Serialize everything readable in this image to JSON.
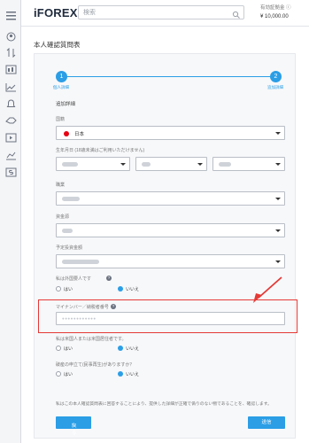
{
  "header": {
    "logo_text": "iFOREX",
    "logo_mark": "«",
    "search_placeholder": "検索",
    "account_caption": "有効証拠金 ⓘ",
    "account_balance": "¥ 10,000.00"
  },
  "rail": {
    "icons": [
      "menu-icon",
      "user-icon",
      "transfer-icon",
      "market-icon",
      "chart-icon",
      "bell-icon",
      "exchange-icon",
      "play-icon",
      "chart-edit-icon",
      "dollar-icon"
    ]
  },
  "page": {
    "title": "本人確認質問表"
  },
  "steps": [
    {
      "number": "1",
      "label": "個人詳細"
    },
    {
      "number": "2",
      "label": "追加詳細"
    }
  ],
  "form": {
    "section_title": "追加詳細",
    "nationality": {
      "label": "国籍",
      "value": "日本"
    },
    "birth": {
      "label": "生年月日 (18歳未満はご利用いただけません)"
    },
    "occupation": {
      "label": "職業"
    },
    "funds": {
      "label": "資金源"
    },
    "planned_amount": {
      "label": "予定投資金額"
    },
    "peps": {
      "label": "私は外国要人です",
      "options": [
        "はい",
        "いいえ"
      ],
      "selected": "いいえ"
    },
    "my_number": {
      "label": "マイナンバー／納税者番号",
      "value": "●●●●●●●●●●●●"
    },
    "us_person": {
      "label": "私は米国人または米国居住者です。",
      "options": [
        "はい",
        "いいえ"
      ],
      "selected": "いいえ"
    },
    "bankruptcy": {
      "label": "破産の申立て(民事再生)がありますか？",
      "options": [
        "はい",
        "いいえ"
      ],
      "selected": "いいえ"
    },
    "notice": "私はこの本人確認質問表に回答することにより、提供した詳細が正確で偽りのない物であることを、確認します。",
    "back_button": "戻る",
    "back_glyph": "‹",
    "submit_button": "送信"
  },
  "colors": {
    "accent": "#2b9ee6",
    "highlight": "#e53935",
    "flag_red": "#e60012"
  }
}
